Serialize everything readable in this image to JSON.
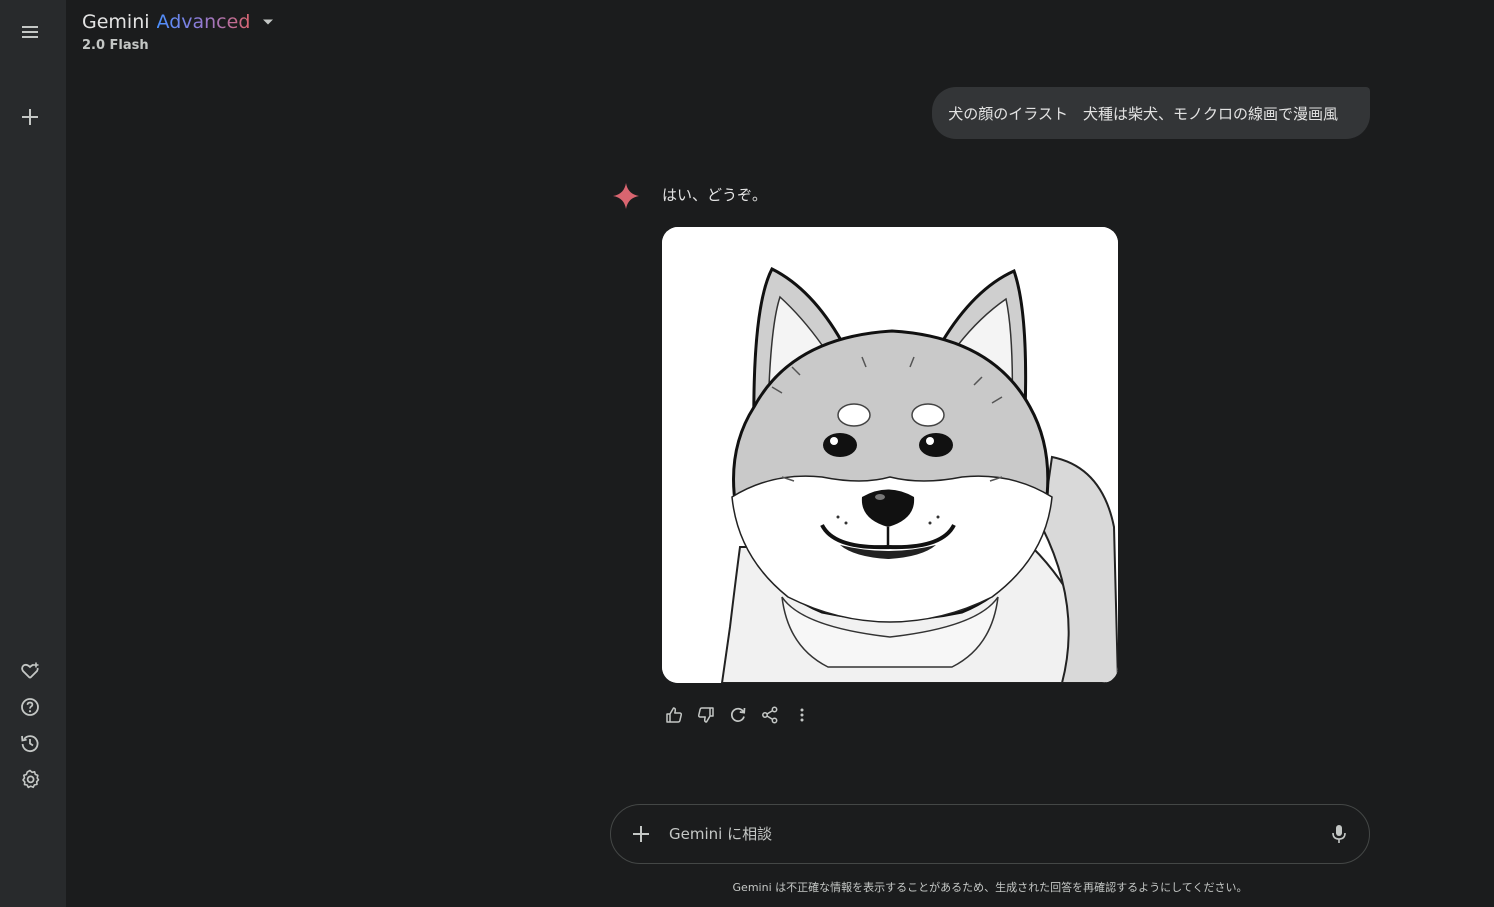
{
  "header": {
    "title_main": "Gemini",
    "title_advanced": "Advanced",
    "model_name": "2.0 Flash"
  },
  "sidebar": {
    "icons": [
      "menu-icon",
      "new-chat-icon",
      "gem-icon",
      "help-icon",
      "history-icon",
      "settings-icon"
    ]
  },
  "conversation": {
    "user_prompt": "犬の顔のイラスト　犬種は柴犬、モノクロの線画で漫画風",
    "model_reply": "はい、どうぞ。",
    "image_subject": "shiba-inu-manga-lineart"
  },
  "actions": [
    "thumbs-up-icon",
    "thumbs-down-icon",
    "regenerate-icon",
    "share-icon",
    "more-options-icon"
  ],
  "composer": {
    "placeholder": "Gemini に相談"
  },
  "footer": {
    "disclaimer": "Gemini は不正確な情報を表示することがあるため、生成された回答を再確認するようにしてください。"
  },
  "colors": {
    "background": "#1b1c1d",
    "sidebar": "#282a2c",
    "user_bubble": "#333537",
    "sparkle": "#d96570",
    "text": "#e3e3e3"
  }
}
